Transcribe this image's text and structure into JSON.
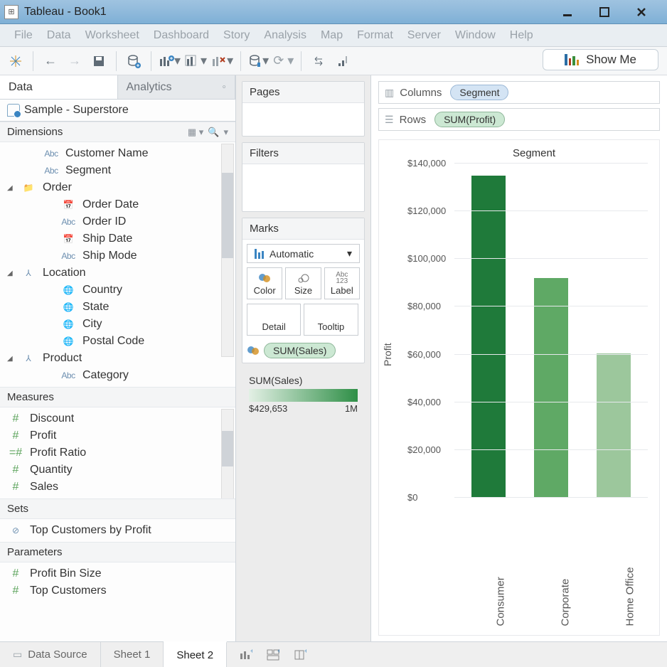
{
  "window": {
    "title": "Tableau - Book1"
  },
  "menu": [
    "File",
    "Data",
    "Worksheet",
    "Dashboard",
    "Story",
    "Analysis",
    "Map",
    "Format",
    "Server",
    "Window",
    "Help"
  ],
  "showme": "Show Me",
  "left": {
    "tabs": {
      "data": "Data",
      "analytics": "Analytics"
    },
    "datasource": "Sample - Superstore",
    "sections": {
      "dimensions": "Dimensions",
      "measures": "Measures",
      "sets": "Sets",
      "parameters": "Parameters"
    },
    "dimensions": {
      "customer_name": "Customer Name",
      "segment": "Segment",
      "order": "Order",
      "order_date": "Order Date",
      "order_id": "Order ID",
      "ship_date": "Ship Date",
      "ship_mode": "Ship Mode",
      "location": "Location",
      "country": "Country",
      "state": "State",
      "city": "City",
      "postal_code": "Postal Code",
      "product": "Product",
      "category": "Category"
    },
    "measures": {
      "discount": "Discount",
      "profit": "Profit",
      "profit_ratio": "Profit Ratio",
      "quantity": "Quantity",
      "sales": "Sales"
    },
    "sets": {
      "top_customers_profit": "Top Customers by Profit"
    },
    "parameters": {
      "profit_bin_size": "Profit Bin Size",
      "top_customers": "Top Customers"
    }
  },
  "cards": {
    "pages": "Pages",
    "filters": "Filters",
    "marks": "Marks",
    "marks_type": "Automatic",
    "color": "Color",
    "size": "Size",
    "label": "Label",
    "detail": "Detail",
    "tooltip": "Tooltip",
    "color_pill": "SUM(Sales)"
  },
  "legend": {
    "title": "SUM(Sales)",
    "min": "$429,653",
    "max": "1M"
  },
  "shelves": {
    "columns_lab": "Columns",
    "rows_lab": "Rows",
    "columns_pill": "Segment",
    "rows_pill": "SUM(Profit)"
  },
  "chart_data": {
    "type": "bar",
    "title": "Segment",
    "ylabel": "Profit",
    "ylim": [
      0,
      140000
    ],
    "yticks": [
      "$0",
      "$20,000",
      "$40,000",
      "$60,000",
      "$80,000",
      "$100,000",
      "$120,000",
      "$140,000"
    ],
    "categories": [
      "Consumer",
      "Corporate",
      "Home Office"
    ],
    "values": [
      135000,
      92000,
      60500
    ],
    "colors": [
      "#1f7a3a",
      "#5fa965",
      "#9cc79c"
    ],
    "color_encoding": "SUM(Sales)"
  },
  "bottom": {
    "datasource": "Data Source",
    "sheet1": "Sheet 1",
    "sheet2": "Sheet 2"
  }
}
